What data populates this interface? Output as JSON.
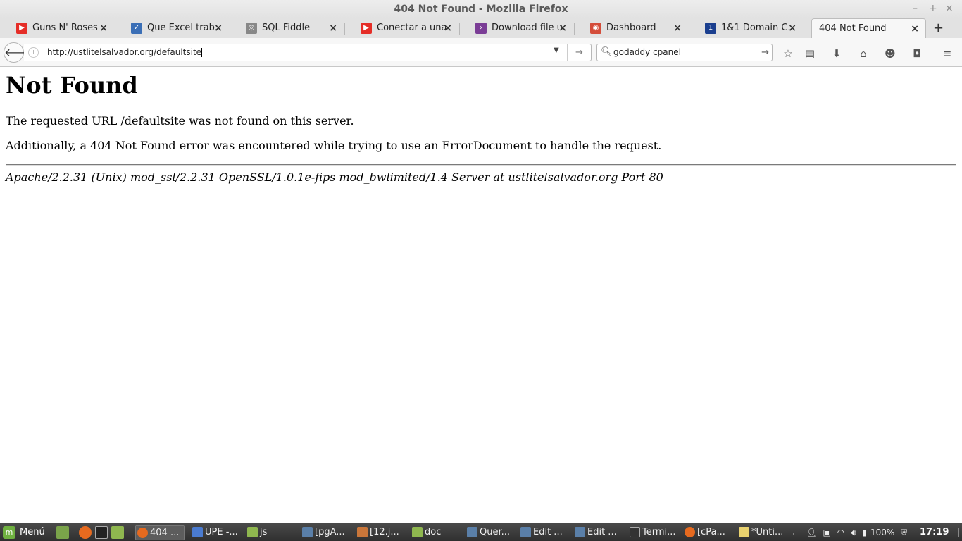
{
  "window": {
    "title": "404 Not Found - Mozilla Firefox",
    "controls": [
      "–",
      "+",
      "×"
    ]
  },
  "tabs": [
    {
      "label": "Guns N' Roses ...",
      "icon": "youtube-icon",
      "color": "#e52d27"
    },
    {
      "label": "Que Excel trab...",
      "icon": "checkmark-site-icon",
      "color": "#3b6fb6"
    },
    {
      "label": "SQL Fiddle",
      "icon": "elephant-icon",
      "color": "#888888"
    },
    {
      "label": "Conectar a una...",
      "icon": "youtube-icon",
      "color": "#e52d27"
    },
    {
      "label": "Download file u...",
      "icon": "purple-arrow-icon",
      "color": "#7b3d96"
    },
    {
      "label": "Dashboard",
      "icon": "dashboard-favicon",
      "color": "#d44d3a"
    },
    {
      "label": "1&1 Domain C...",
      "icon": "1and1-icon",
      "color": "#1b3f8f"
    },
    {
      "label": "404 Not Found",
      "icon": "",
      "color": ""
    }
  ],
  "navbar": {
    "url": "http://ustlitelsalvador.org/defaultsite",
    "search_value": "godaddy cpanel"
  },
  "page": {
    "heading": "Not Found",
    "para1": "The requested URL /defaultsite was not found on this server.",
    "para2": "Additionally, a 404 Not Found error was encountered while trying to use an ErrorDocument to handle the request.",
    "address": "Apache/2.2.31 (Unix) mod_ssl/2.2.31 OpenSSL/1.0.1e-fips mod_bwlimited/1.4 Server at ustlitelsalvador.org Port 80"
  },
  "taskbar": {
    "menu_label": "Menú",
    "tasks": [
      {
        "label": "404 ...",
        "icon": "firefox-icon",
        "color": "#e66a1f",
        "active": true
      },
      {
        "label": "UPE -...",
        "icon": "box-icon",
        "color": "#4a7bd0",
        "active": false
      },
      {
        "label": "js",
        "icon": "folder-icon",
        "color": "#8fb74f",
        "active": false
      },
      {
        "label": "[pgA...",
        "icon": "pgadmin-icon",
        "color": "#5a7fa8",
        "active": false
      },
      {
        "label": "[12.j...",
        "icon": "image-viewer-icon",
        "color": "#c9763a",
        "active": false
      },
      {
        "label": "doc",
        "icon": "folder-icon",
        "color": "#8fb74f",
        "active": false
      },
      {
        "label": "Quer...",
        "icon": "pgadmin-icon",
        "color": "#5a7fa8",
        "active": false
      },
      {
        "label": "Edit ...",
        "icon": "pgadmin-icon",
        "color": "#5a7fa8",
        "active": false
      },
      {
        "label": "Edit ...",
        "icon": "pgadmin-icon",
        "color": "#5a7fa8",
        "active": false
      },
      {
        "label": "Termi...",
        "icon": "terminal-icon",
        "color": "#333333",
        "active": false
      },
      {
        "label": "[cPa...",
        "icon": "firefox-icon",
        "color": "#e66a1f",
        "active": false
      },
      {
        "label": "*Unti...",
        "icon": "text-editor-icon",
        "color": "#e9d26f",
        "active": false
      }
    ],
    "battery": "100%",
    "clock": "17:19"
  }
}
